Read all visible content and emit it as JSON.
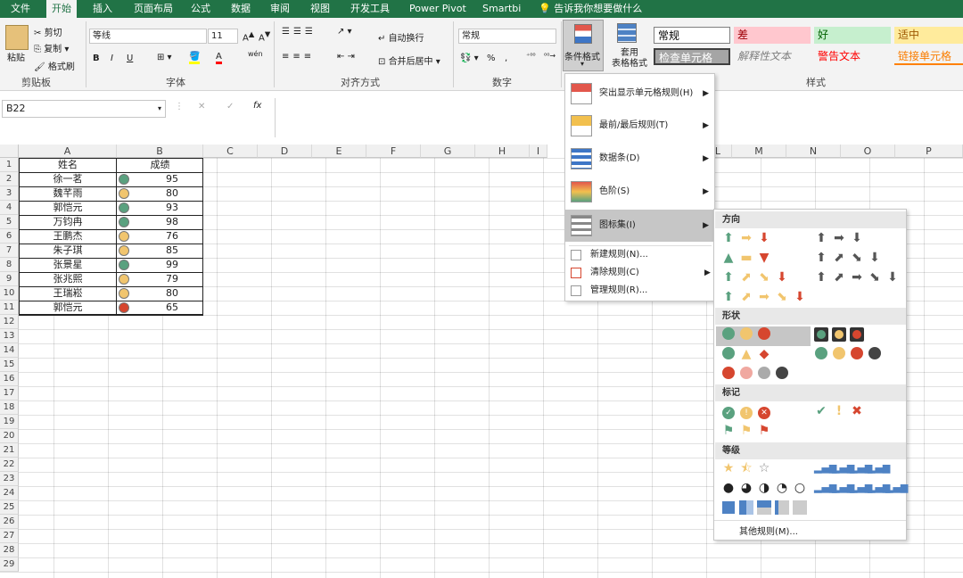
{
  "tabs": [
    "文件",
    "开始",
    "插入",
    "页面布局",
    "公式",
    "数据",
    "审阅",
    "视图",
    "开发工具",
    "Power Pivot",
    "Smartbi"
  ],
  "tell_me": "告诉我你想要做什么",
  "clipboard": {
    "paste": "粘贴",
    "cut": "剪切",
    "copy": "复制",
    "format_painter": "格式刷",
    "group": "剪贴板"
  },
  "font": {
    "name": "等线",
    "size": "11",
    "bold": "B",
    "italic": "I",
    "underline": "U",
    "fill": "wén",
    "group": "字体"
  },
  "align": {
    "wrap": "自动换行",
    "merge": "合并后居中",
    "group": "对齐方式"
  },
  "number": {
    "format": "常规",
    "percent": "%",
    "group": "数字"
  },
  "styles": {
    "cond_format": "条件格式",
    "table_format": "套用\n表格格式",
    "group": "样式",
    "cells": [
      {
        "label": "常规",
        "bg": "#ffffff",
        "fg": "#000000"
      },
      {
        "label": "差",
        "bg": "#ffc7ce",
        "fg": "#9c0006"
      },
      {
        "label": "好",
        "bg": "#c6efce",
        "fg": "#006100"
      },
      {
        "label": "适中",
        "bg": "#ffeb9c",
        "fg": "#9c5700"
      },
      {
        "label": "检查单元格",
        "bg": "#a5a5a5",
        "fg": "#ffffff"
      },
      {
        "label": "解释性文本",
        "bg": "#f3f3f3",
        "fg": "#7f7f7f"
      },
      {
        "label": "警告文本",
        "bg": "#f3f3f3",
        "fg": "#ff0000"
      },
      {
        "label": "链接单元格",
        "bg": "#f3f3f3",
        "fg": "#fa7d00"
      }
    ]
  },
  "formula": {
    "name_box": "B22",
    "fx": "fx"
  },
  "columns": [
    "A",
    "B",
    "C",
    "D",
    "E",
    "F",
    "G",
    "H",
    "I",
    "L",
    "M",
    "N",
    "O",
    "P"
  ],
  "rows": [
    "1",
    "2",
    "3",
    "4",
    "5",
    "6",
    "7",
    "8",
    "9",
    "10",
    "11",
    "12",
    "13",
    "14",
    "15",
    "16",
    "17",
    "18",
    "19",
    "20",
    "21",
    "22",
    "23",
    "24",
    "25",
    "26",
    "27",
    "28",
    "29"
  ],
  "table": {
    "header": [
      "姓名",
      "成绩"
    ],
    "data": [
      {
        "name": "徐一茗",
        "score": "95",
        "icon": "green"
      },
      {
        "name": "魏芊雨",
        "score": "80",
        "icon": "yellow"
      },
      {
        "name": "郭恺元",
        "score": "93",
        "icon": "green"
      },
      {
        "name": "万钧冉",
        "score": "98",
        "icon": "green"
      },
      {
        "name": "王鹏杰",
        "score": "76",
        "icon": "yellow"
      },
      {
        "name": "朱子琪",
        "score": "85",
        "icon": "yellow"
      },
      {
        "name": "张景星",
        "score": "99",
        "icon": "green"
      },
      {
        "name": "张兆熙",
        "score": "79",
        "icon": "yellow"
      },
      {
        "name": "王瑞崧",
        "score": "80",
        "icon": "yellow"
      },
      {
        "name": "郭恺元",
        "score": "65",
        "icon": "red"
      }
    ]
  },
  "icon_colors": {
    "green": "#5aa17f",
    "yellow": "#f1c56e",
    "red": "#d6462f"
  },
  "cf_menu": {
    "items": [
      "突出显示单元格规则(H)",
      "最前/最后规则(T)",
      "数据条(D)",
      "色阶(S)",
      "图标集(I)"
    ],
    "small": [
      "新建规则(N)...",
      "清除规则(C)",
      "管理规则(R)..."
    ]
  },
  "iconset": {
    "sections": [
      "方向",
      "形状",
      "标记",
      "等级"
    ],
    "more": "其他规则(M)..."
  }
}
